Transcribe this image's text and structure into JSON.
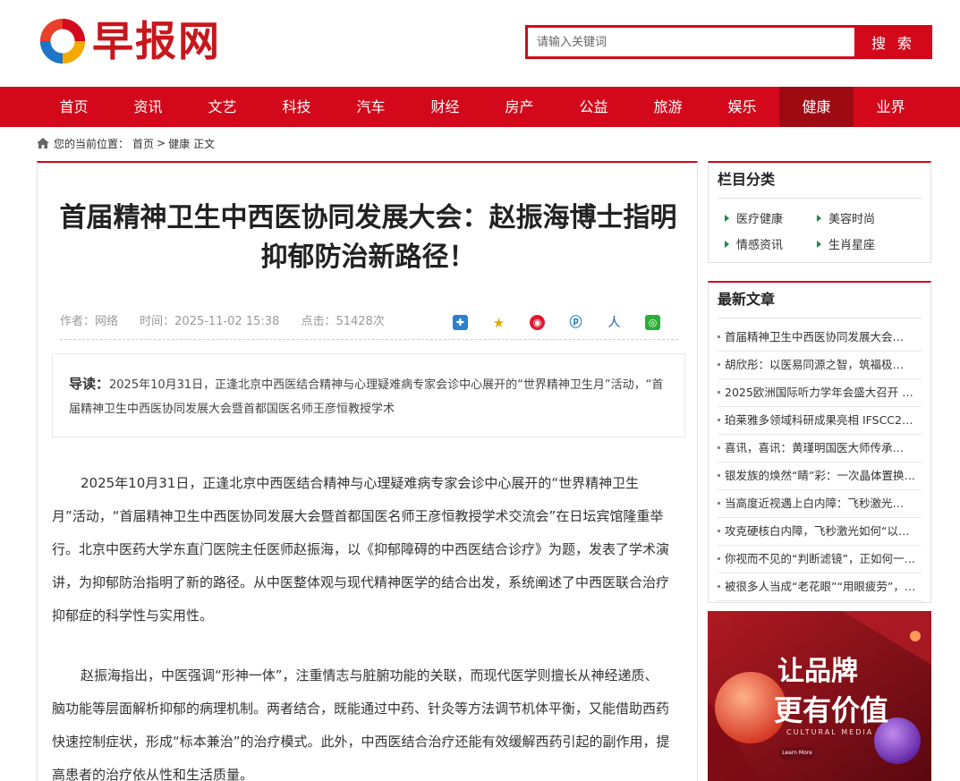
{
  "header": {
    "logo_text": "早报网",
    "search_placeholder": "请输入关键词",
    "search_button": "搜 索"
  },
  "nav": {
    "items": [
      "首页",
      "资讯",
      "文艺",
      "科技",
      "汽车",
      "财经",
      "房产",
      "公益",
      "旅游",
      "娱乐",
      "健康",
      "业界"
    ],
    "active": "健康"
  },
  "breadcrumb": {
    "prefix": "您的当前位置：",
    "home": "首页",
    "sep": ">",
    "section": "健康",
    "tail": "正文"
  },
  "article": {
    "title": "首届精神卫生中西医协同发展大会：赵振海博士指明抑郁防治新路径！",
    "author": "作者：网络",
    "time": "时间：2025-11-02 15:38",
    "clicks": "点击：51428次",
    "lead_label": "导读：",
    "lead_text": "2025年10月31日，正逢北京中西医结合精神与心理疑难病专家会诊中心展开的“世界精神卫生月”活动，“首届精神卫生中西医协同发展大会暨首都国医名师王彦恒教授学术",
    "paragraphs": [
      "2025年10月31日，正逢北京中西医结合精神与心理疑难病专家会诊中心展开的“世界精神卫生月”活动，“首届精神卫生中西医协同发展大会暨首都国医名师王彦恒教授学术交流会”在日坛宾馆隆重举行。北京中医药大学东直门医院主任医师赵振海，以《抑郁障碍的中西医结合诊疗》为题，发表了学术演讲，为抑郁防治指明了新的路径。从中医整体观与现代精神医学的结合出发，系统阐述了中西医联合治疗抑郁症的科学性与实用性。",
      "赵振海指出，中医强调“形神一体”，注重情志与脏腑功能的关联，而现代医学则擅长从神经递质、脑功能等层面解析抑郁的病理机制。两者结合，既能通过中药、针灸等方法调节机体平衡，又能借助西药快速控制症状，形成“标本兼治”的治疗模式。此外，中西医结合治疗还能有效缓解西药引起的副作用，提高患者的治疗依从性和生活质量。"
    ]
  },
  "sidebar": {
    "categories_title": "栏目分类",
    "categories": [
      "医疗健康",
      "美容时尚",
      "情感资讯",
      "生肖星座"
    ],
    "latest_title": "最新文章",
    "latest": [
      "首届精神卫生中西医协同发展大会…",
      "胡欣彤：以医易同源之智，筑福极…",
      "2025欧洲国际听力学年会盛大召开 …",
      "珀莱雅多领域科研成果亮相 IFSCC2…",
      "喜讯，喜讯：黄瑾明国医大师传承…",
      "银发族的焕然“睛”彩：一次晶体置换…",
      "当高度近视遇上白内障：飞秒激光…",
      "攻克硬核白内障，飞秒激光如何“以…",
      "你视而不见的“判断滤镜”，正如何一…",
      "被很多人当成“老花眼”“用眼疲劳”，…"
    ]
  },
  "ad": {
    "line1": "让品牌",
    "line2": "更有价值",
    "sub": "CULTURAL MEDIA",
    "button": "Learn More"
  },
  "colors": {
    "brand_red": "#d3091b",
    "nav_active": "#9e0a12",
    "share_green": "#1a8a3a"
  },
  "icons": [
    "logo-swirl-icon",
    "home-icon",
    "share-plus-icon",
    "share-star-icon",
    "weibo-icon",
    "pinterest-icon",
    "renren-icon",
    "wechat-icon",
    "triangle-bullet-icon"
  ]
}
